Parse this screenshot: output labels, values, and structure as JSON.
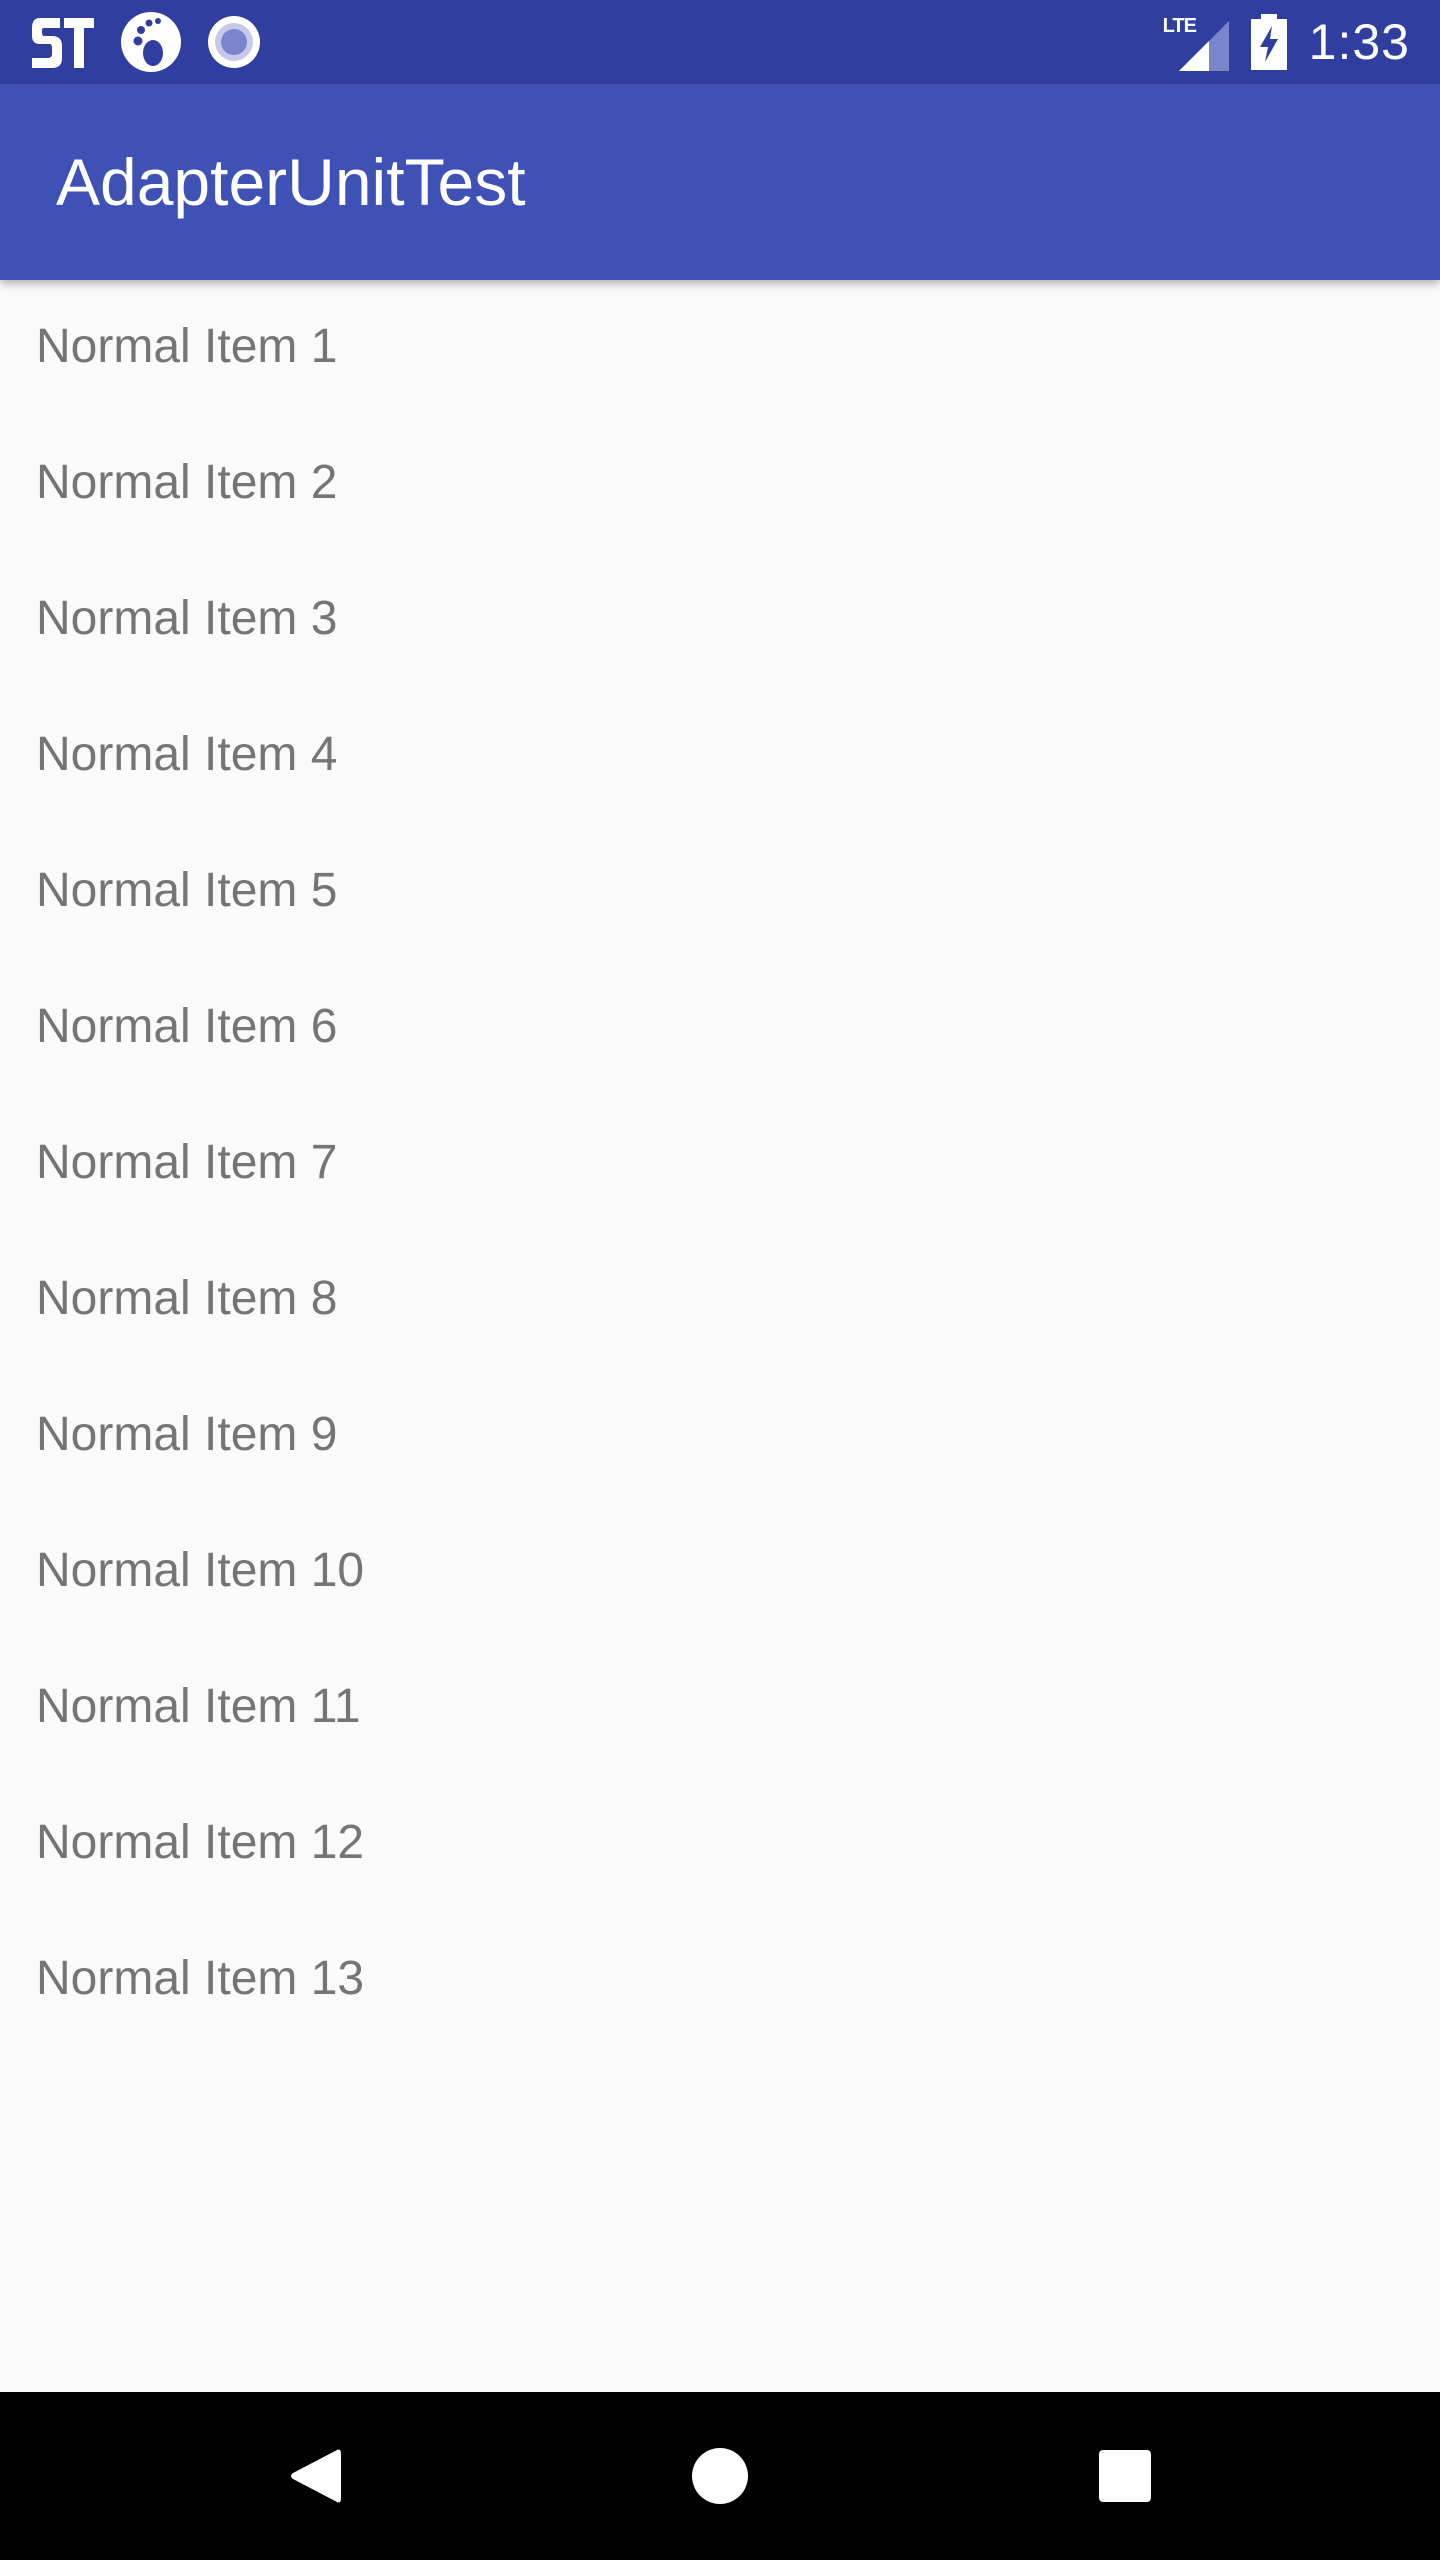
{
  "status_bar": {
    "background": "#303F9F",
    "icons_left": [
      "st-logo-icon",
      "paw-icon",
      "radio-button-icon"
    ],
    "network_label": "LTE",
    "time": "1:33"
  },
  "app_bar": {
    "background": "#3F51B5",
    "title": "AdapterUnitTest"
  },
  "list": {
    "items": [
      {
        "label": "Normal Item 1"
      },
      {
        "label": "Normal Item 2"
      },
      {
        "label": "Normal Item 3"
      },
      {
        "label": "Normal Item 4"
      },
      {
        "label": "Normal Item 5"
      },
      {
        "label": "Normal Item 6"
      },
      {
        "label": "Normal Item 7"
      },
      {
        "label": "Normal Item 8"
      },
      {
        "label": "Normal Item 9"
      },
      {
        "label": "Normal Item 10"
      },
      {
        "label": "Normal Item 11"
      },
      {
        "label": "Normal Item 12"
      },
      {
        "label": "Normal Item 13"
      }
    ]
  },
  "nav_bar": {
    "buttons": [
      "back-icon",
      "home-icon",
      "recents-icon"
    ]
  }
}
